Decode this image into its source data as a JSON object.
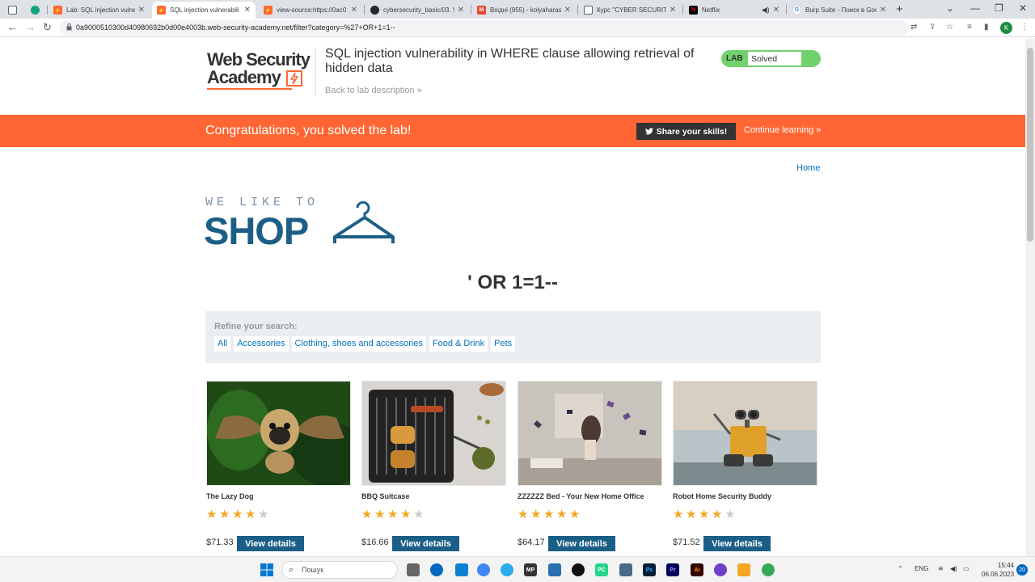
{
  "browser": {
    "tabs": [
      {
        "title": "",
        "icon": "generic-page-icon",
        "color": "#5f6368"
      },
      {
        "title": "",
        "icon": "chatgpt-icon",
        "color": "#10a37f"
      },
      {
        "title": "Lab: SQL injection vulnera",
        "icon": "portswigger-icon",
        "color": "#ff6633"
      },
      {
        "title": "SQL injection vulnerabili",
        "icon": "portswigger-icon",
        "color": "#ff6633"
      },
      {
        "title": "view-source:https://0ac0",
        "icon": "portswigger-icon",
        "color": "#ff6633"
      },
      {
        "title": "cybersecurity_basic/03. S",
        "icon": "github-icon",
        "color": "#24292e"
      },
      {
        "title": "Вхідні (955) - kolyaharas",
        "icon": "gmail-icon",
        "color": "#ea4335"
      },
      {
        "title": "Курс \"CYBER SECURITY B",
        "icon": "course-icon",
        "color": "#5f6368"
      },
      {
        "title": "Netflix",
        "icon": "netflix-icon",
        "color": "#e50914"
      },
      {
        "title": "",
        "icon": "speaker-icon",
        "color": "#3c4043"
      },
      {
        "title": "Burp Suite - Поиск в Goo",
        "icon": "google-icon",
        "color": "#4285f4"
      }
    ],
    "new_tab": "+",
    "url": "0a9000510300d40980692b0d00e4003b.web-security-academy.net/filter?category=%27+OR+1=1--",
    "profile_initial": "K"
  },
  "lab": {
    "logo_line1": "Web Security",
    "logo_line2": "Academy",
    "title": "SQL injection vulnerability in WHERE clause allowing retrieval of hidden data",
    "back_link": "Back to lab description »",
    "status_label": "LAB",
    "status_value": "Solved"
  },
  "banner": {
    "message": "Congratulations, you solved the lab!",
    "share_label": "Share your skills!",
    "continue_label": "Continue learning »"
  },
  "shop": {
    "home_link": "Home",
    "tagline": "WE LIKE TO",
    "brand": "SHOP",
    "query_heading": "' OR 1=1--",
    "refine_label": "Refine your search:",
    "filters": [
      "All",
      "Accessories",
      "Clothing, shoes and accessories",
      "Food & Drink",
      "Pets"
    ],
    "products": [
      {
        "name": "The Lazy Dog",
        "rating": 4,
        "price": "$71.33",
        "button": "View details"
      },
      {
        "name": "BBQ Suitcase",
        "rating": 4,
        "price": "$16.66",
        "button": "View details"
      },
      {
        "name": "ZZZZZZ Bed - Your New Home Office",
        "rating": 5,
        "price": "$64.17",
        "button": "View details"
      },
      {
        "name": "Robot Home Security Buddy",
        "rating": 4,
        "price": "$71.52",
        "button": "View details"
      }
    ]
  },
  "taskbar": {
    "search_placeholder": "Пошук",
    "language": "ENG",
    "time": "15:44",
    "date": "06.06.2023",
    "notifications": "20"
  },
  "colors": {
    "accent": "#ff6633",
    "shop_blue": "#1b5f87",
    "link": "#0071bc",
    "solved_green": "#70d16d",
    "star": "#f5a623"
  }
}
